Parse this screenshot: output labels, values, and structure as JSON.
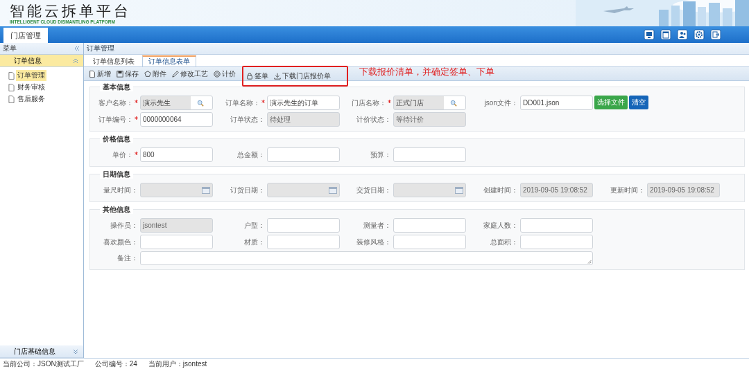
{
  "header": {
    "title": "智能云拆单平台",
    "subtitle": "INTELLIGENT CLOUD DISMANTLING PLATFORM"
  },
  "top_tabs": [
    {
      "label": "门店管理",
      "selected": true
    }
  ],
  "sidebar": {
    "title": "菜单",
    "groups": [
      {
        "label": "订单信息",
        "expanded": true,
        "items": [
          {
            "label": "订单管理",
            "selected": true
          },
          {
            "label": "财务审核",
            "selected": false
          },
          {
            "label": "售后服务",
            "selected": false
          }
        ]
      },
      {
        "label": "门店基础信息",
        "expanded": false
      }
    ]
  },
  "breadcrumb": "订单管理",
  "tabs": [
    {
      "label": "订单信息列表",
      "selected": false
    },
    {
      "label": "订单信息表单",
      "selected": true
    }
  ],
  "toolbar": [
    {
      "label": "新增",
      "kind": "new"
    },
    {
      "label": "保存",
      "kind": "save"
    },
    {
      "label": "附件",
      "kind": "attach"
    },
    {
      "label": "修改工艺",
      "kind": "edit"
    },
    {
      "label": "计价",
      "kind": "price"
    },
    {
      "label": "签单",
      "kind": "sign"
    },
    {
      "label": "下载门店报价单",
      "kind": "download"
    }
  ],
  "annotation": {
    "text": "下载报价清单，并确定签单、下单"
  },
  "sections": [
    {
      "title": "基本信息",
      "rows": [
        [
          {
            "label": "客户名称：",
            "required": true,
            "kind": "lookup",
            "value": "演示先生"
          },
          {
            "label": "订单名称：",
            "required": true,
            "kind": "text",
            "value": "演示先生的订单"
          },
          {
            "label": "门店名称：",
            "required": true,
            "kind": "lookup",
            "value": "正式门店"
          },
          {
            "label": "json文件：",
            "required": false,
            "kind": "file",
            "value": "DD001.json",
            "buttons": [
              "选择文件",
              "清空"
            ]
          }
        ],
        [
          {
            "label": "订单编号：",
            "required": true,
            "kind": "text",
            "value": "0000000064"
          },
          {
            "label": "订单状态：",
            "required": false,
            "kind": "readonly",
            "value": "待处理"
          },
          {
            "label": "计价状态：",
            "required": false,
            "kind": "readonly",
            "value": "等待计价"
          }
        ]
      ]
    },
    {
      "title": "价格信息",
      "rows": [
        [
          {
            "label": "单价：",
            "required": true,
            "kind": "text",
            "value": "800"
          },
          {
            "label": "总金额：",
            "required": false,
            "kind": "text"
          },
          {
            "label": "预算：",
            "required": false,
            "kind": "text"
          }
        ]
      ]
    },
    {
      "title": "日期信息",
      "rows": [
        [
          {
            "label": "量尺时间：",
            "required": false,
            "kind": "date"
          },
          {
            "label": "订货日期：",
            "required": false,
            "kind": "date"
          },
          {
            "label": "交货日期：",
            "required": false,
            "kind": "date"
          },
          {
            "label": "创建时间：",
            "required": false,
            "kind": "readonly",
            "value": "2019-09-05 19:08:52"
          },
          {
            "label": "更新时间：",
            "required": false,
            "kind": "readonly",
            "value": "2019-09-05 19:08:52"
          }
        ]
      ]
    },
    {
      "title": "其他信息",
      "rows": [
        [
          {
            "label": "操作员：",
            "required": false,
            "kind": "readonly",
            "value": "jsontest"
          },
          {
            "label": "户型：",
            "required": false,
            "kind": "text"
          },
          {
            "label": "测量者：",
            "required": false,
            "kind": "text"
          },
          {
            "label": "家庭人数：",
            "required": false,
            "kind": "text"
          }
        ],
        [
          {
            "label": "喜欢颜色：",
            "required": false,
            "kind": "text"
          },
          {
            "label": "材质：",
            "required": false,
            "kind": "text"
          },
          {
            "label": "装修风格：",
            "required": false,
            "kind": "text"
          },
          {
            "label": "总面积：",
            "required": false,
            "kind": "text"
          }
        ],
        [
          {
            "label": "备注：",
            "required": false,
            "kind": "textarea"
          }
        ]
      ]
    }
  ],
  "status_bar": [
    "当前公司：JSON测试工厂",
    "公司编号：24",
    "当前用户：jsontest"
  ]
}
